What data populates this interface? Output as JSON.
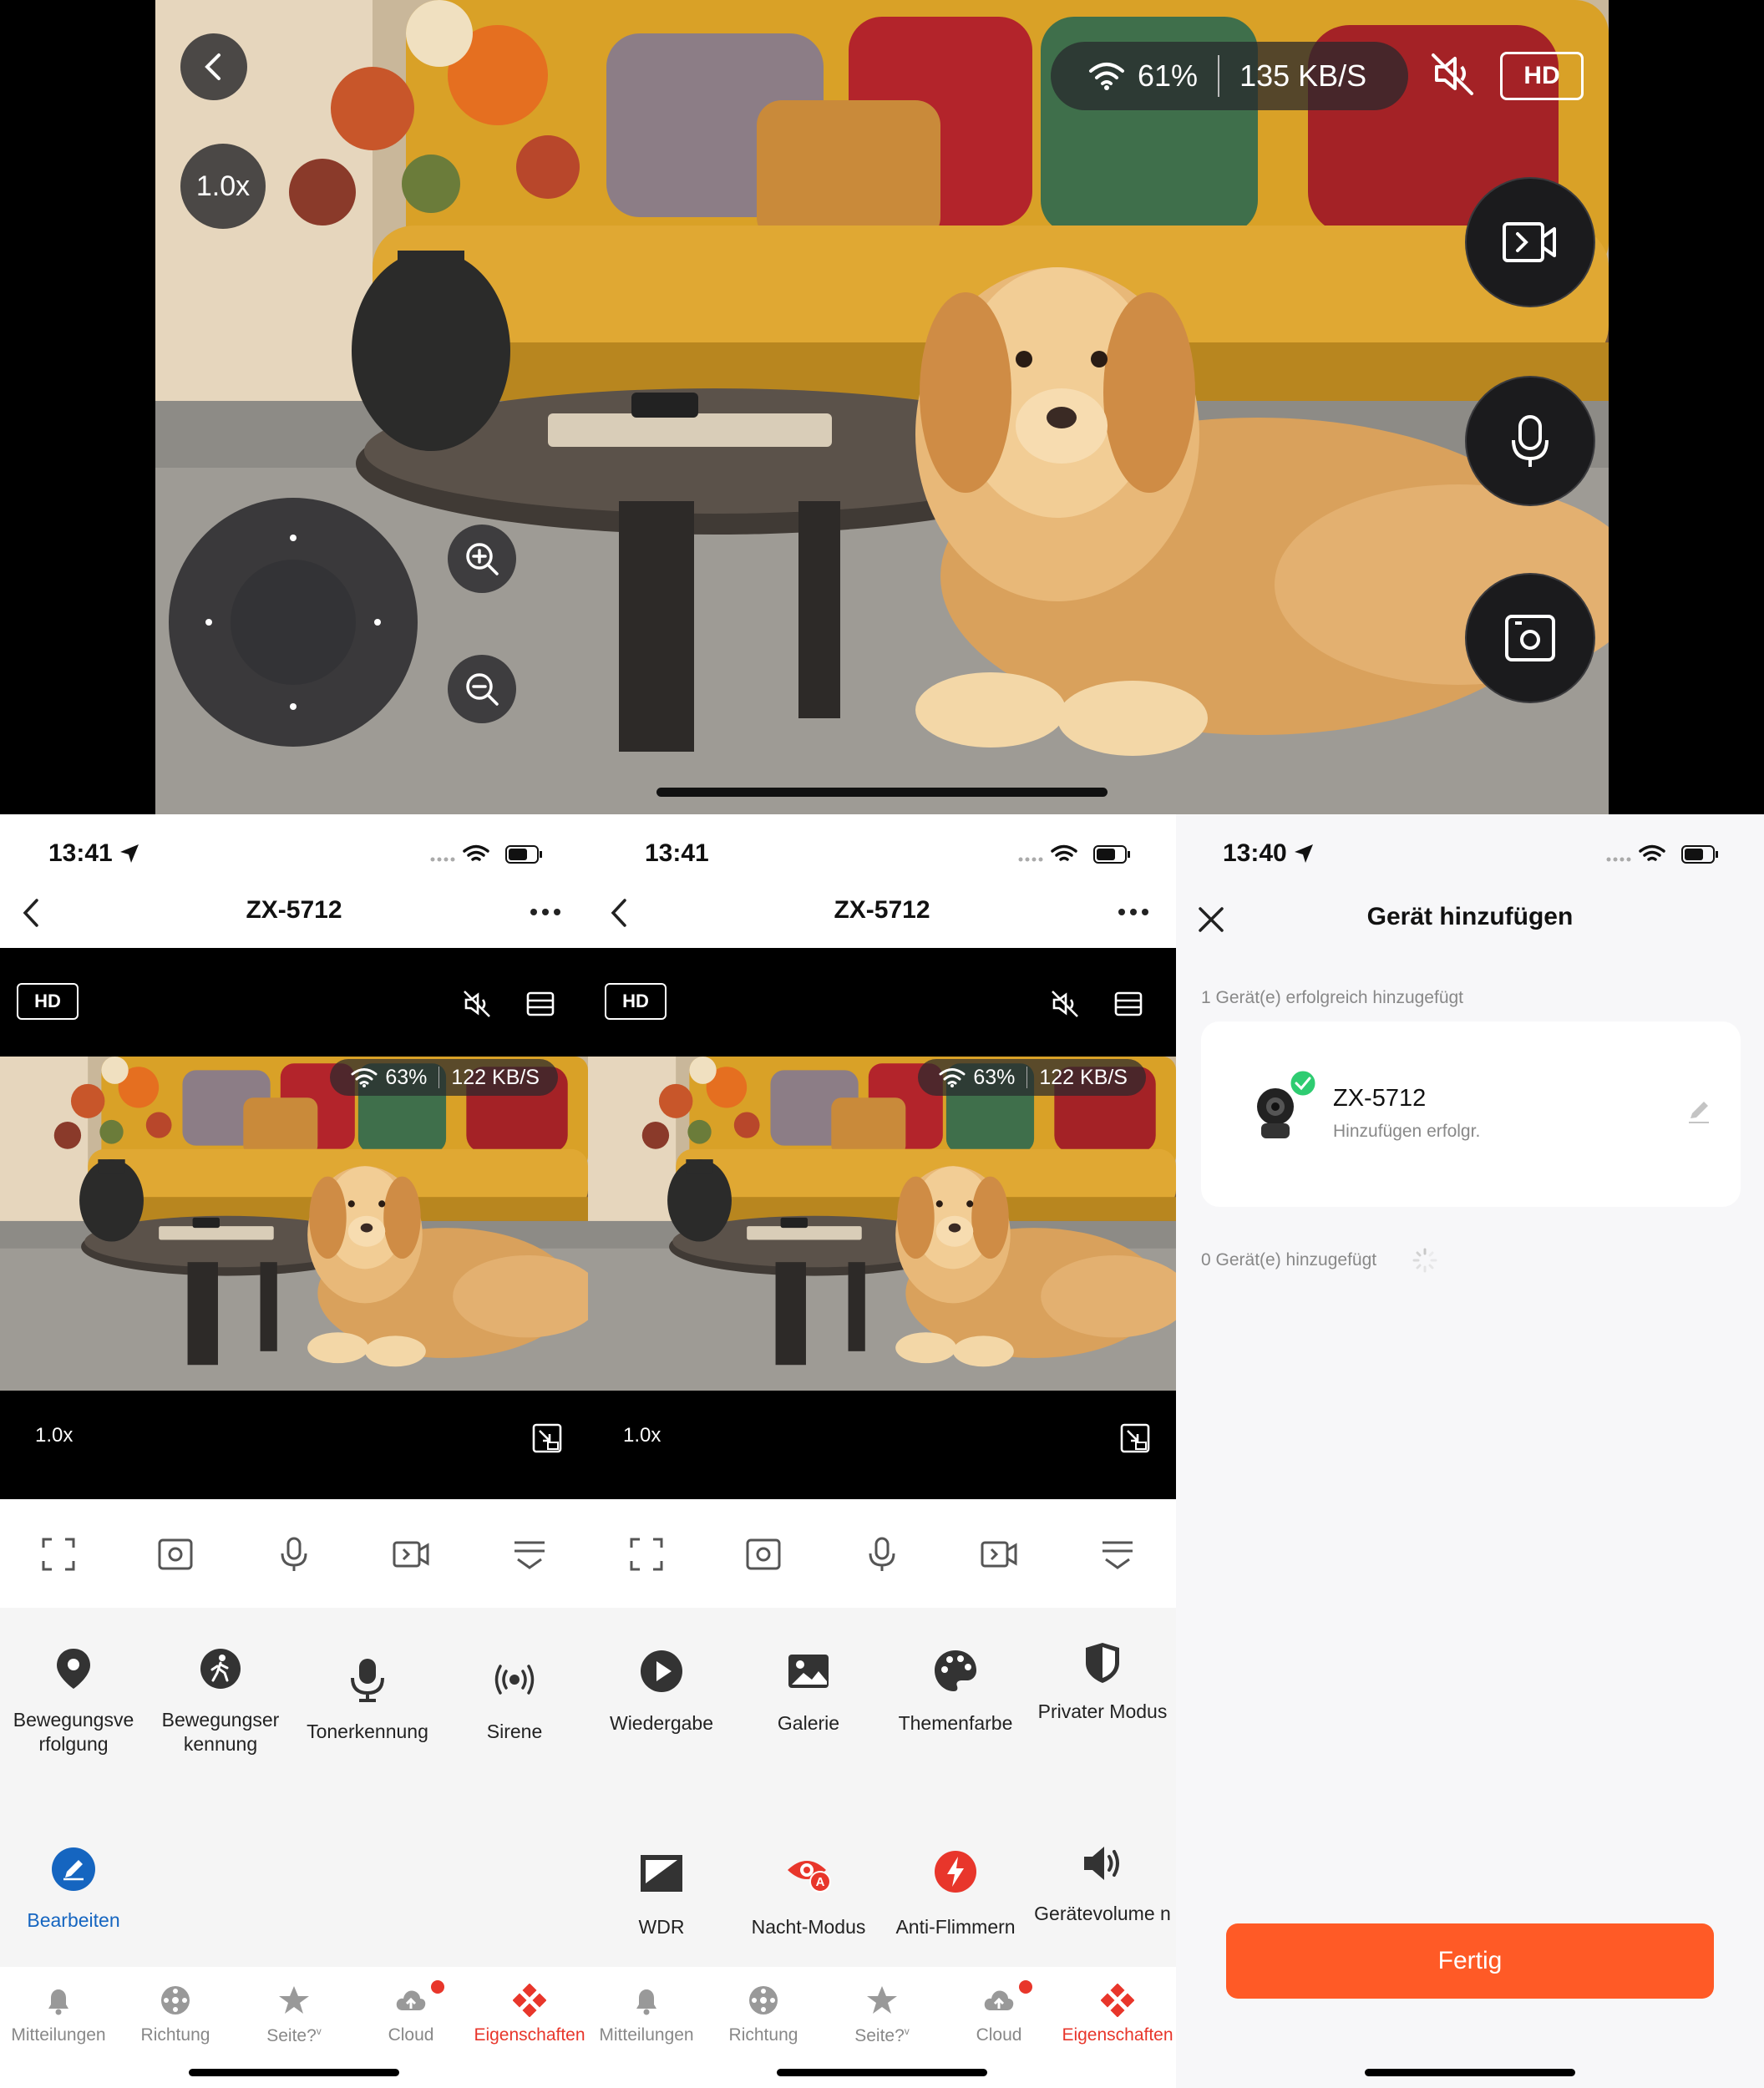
{
  "top_view": {
    "zoom": "1.0x",
    "signal_percent": "61%",
    "bitrate": "135 KB/S",
    "hd_label": "HD"
  },
  "phones": [
    {
      "time": "13:41",
      "title": "ZX-5712",
      "hd_label": "HD",
      "signal_percent": "63%",
      "bitrate": "122 KB/S",
      "zoom": "1.0x",
      "grid": [
        {
          "label": "Bewegungsve rfolgung",
          "icon": "location-pin-icon"
        },
        {
          "label": "Bewegungser kennung",
          "icon": "walking-person-icon"
        },
        {
          "label": "Tonerkennung",
          "icon": "microphone-icon"
        },
        {
          "label": "Sirene",
          "icon": "siren-icon"
        }
      ],
      "edit_label": "Bearbeiten",
      "tabs": [
        "Mitteilungen",
        "Richtung",
        "Seite?",
        "Cloud",
        "Eigenschaften"
      ],
      "tab_sup": "v"
    },
    {
      "time": "13:41",
      "title": "ZX-5712",
      "hd_label": "HD",
      "signal_percent": "63%",
      "bitrate": "122 KB/S",
      "zoom": "1.0x",
      "grid": [
        {
          "label": "Wiedergabe",
          "icon": "play-icon"
        },
        {
          "label": "Galerie",
          "icon": "gallery-icon"
        },
        {
          "label": "Themenfarbe",
          "icon": "palette-icon"
        },
        {
          "label": "Privater Modus",
          "icon": "shield-icon"
        },
        {
          "label": "WDR",
          "icon": "wdr-icon"
        },
        {
          "label": "Nacht-Modus",
          "icon": "night-eye-icon"
        },
        {
          "label": "Anti-Flimmern",
          "icon": "flash-icon"
        },
        {
          "label": "Gerätevolume n",
          "icon": "speaker-icon"
        }
      ],
      "tabs": [
        "Mitteilungen",
        "Richtung",
        "Seite?",
        "Cloud",
        "Eigenschaften"
      ],
      "tab_sup": "v"
    }
  ],
  "add_device": {
    "time": "13:40",
    "title": "Gerät hinzufügen",
    "success_caption": "1 Gerät(e) erfolgreich hinzugefügt",
    "device_name": "ZX-5712",
    "device_status": "Hinzufügen erfolgr.",
    "pending_caption": "0 Gerät(e) hinzugefügt",
    "done_button": "Fertig"
  },
  "colors": {
    "accent_red": "#e8362b",
    "edit_blue": "#1565c0",
    "done_orange": "#ff5a26",
    "success_green": "#2ecc71"
  }
}
